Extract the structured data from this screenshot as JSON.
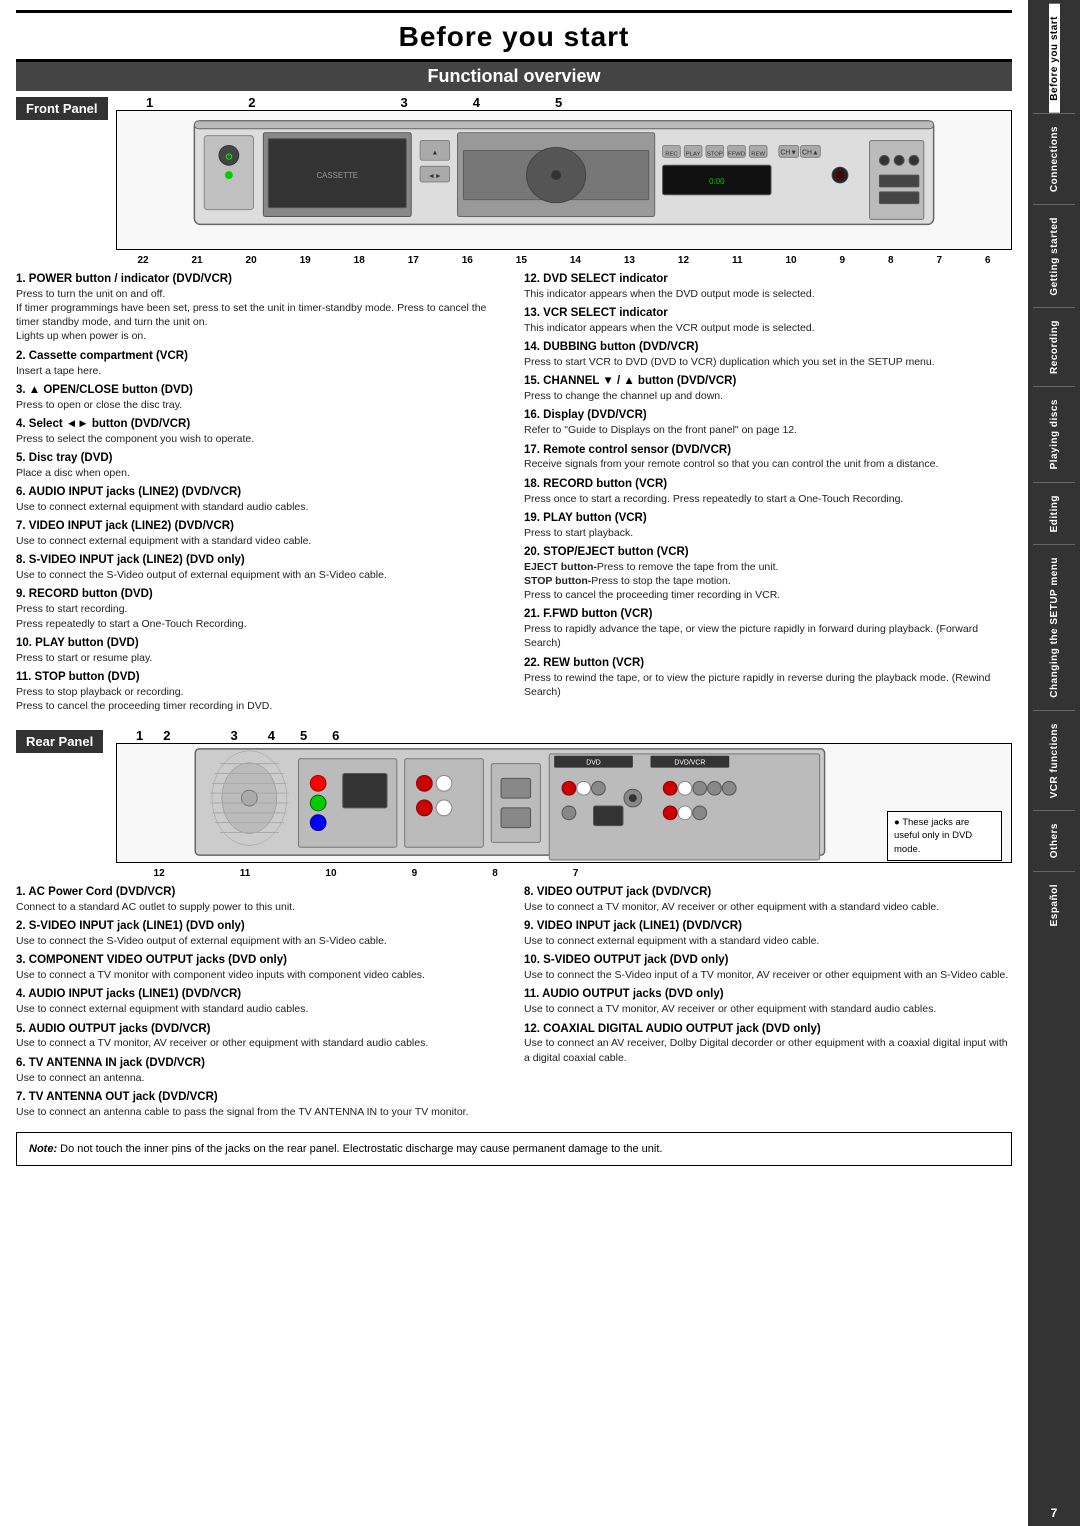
{
  "page": {
    "title": "Before you start",
    "section": "Functional overview",
    "page_number": "7"
  },
  "sidebar": {
    "sections": [
      {
        "label": "Before you start",
        "active": true
      },
      {
        "label": "Connections",
        "active": false
      },
      {
        "label": "Getting started",
        "active": false
      },
      {
        "label": "Recording",
        "active": false
      },
      {
        "label": "Playing discs",
        "active": false
      },
      {
        "label": "Editing",
        "active": false
      },
      {
        "label": "Changing the SETUP menu",
        "active": false
      },
      {
        "label": "VCR functions",
        "active": false
      },
      {
        "label": "Others",
        "active": false
      },
      {
        "label": "Español",
        "active": false
      }
    ]
  },
  "front_panel": {
    "label": "Front Panel",
    "top_numbers": [
      "1",
      "2",
      "3",
      "4",
      "5"
    ],
    "bottom_numbers": [
      "22",
      "21",
      "20",
      "19",
      "18",
      "17",
      "16",
      "15",
      "14",
      "13",
      "12",
      "11",
      "10",
      "9",
      "8",
      "7",
      "6"
    ],
    "items": [
      {
        "num": "1",
        "title": "POWER button / indicator (DVD/VCR)",
        "body": "Press to turn the unit on and off.\nIf timer programmings have been set, press to set the unit in timer-standby mode. Press to cancel the timer standby mode, and turn the unit on.\nLights up when power is on."
      },
      {
        "num": "2",
        "title": "Cassette compartment (VCR)",
        "body": "Insert a tape here."
      },
      {
        "num": "3",
        "title": "▲ OPEN/CLOSE button (DVD)",
        "body": "Press to open or close the disc tray."
      },
      {
        "num": "4",
        "title": "Select ◄► button (DVD/VCR)",
        "body": "Press to select the component you wish to operate."
      },
      {
        "num": "5",
        "title": "Disc tray (DVD)",
        "body": "Place a disc when open."
      },
      {
        "num": "6",
        "title": "AUDIO INPUT jacks (LINE2) (DVD/VCR)",
        "body": "Use to connect external equipment with standard audio cables."
      },
      {
        "num": "7",
        "title": "VIDEO INPUT jack (LINE2) (DVD/VCR)",
        "body": "Use to connect external equipment with a standard video cable."
      },
      {
        "num": "8",
        "title": "S-VIDEO INPUT jack (LINE2) (DVD only)",
        "body": "Use to connect the S-Video output of external equipment with an S-Video cable."
      },
      {
        "num": "9",
        "title": "RECORD button (DVD)",
        "body": "Press to start recording.\nPress repeatedly to start a One-Touch Recording."
      },
      {
        "num": "10",
        "title": "PLAY button (DVD)",
        "body": "Press to start or resume play."
      },
      {
        "num": "11",
        "title": "STOP button (DVD)",
        "body": "Press to stop playback or recording.\nPress to cancel the proceeding timer recording in DVD."
      },
      {
        "num": "12",
        "title": "DVD SELECT indicator",
        "body": "This indicator appears when the DVD output mode is selected."
      },
      {
        "num": "13",
        "title": "VCR SELECT indicator",
        "body": "This indicator appears when the VCR output mode is selected."
      },
      {
        "num": "14",
        "title": "DUBBING button (DVD/VCR)",
        "body": "Press to start VCR to DVD (DVD to VCR) duplication which you set in the SETUP menu."
      },
      {
        "num": "15",
        "title": "CHANNEL ▼ / ▲ button (DVD/VCR)",
        "body": "Press to change the channel up and down."
      },
      {
        "num": "16",
        "title": "Display (DVD/VCR)",
        "body": "Refer to \"Guide to Displays on the front panel\" on page 12."
      },
      {
        "num": "17",
        "title": "Remote control sensor (DVD/VCR)",
        "body": "Receive signals from your remote control so that you can control the unit from a distance."
      },
      {
        "num": "18",
        "title": "RECORD button (VCR)",
        "body": "Press once to start a recording. Press repeatedly to start a One-Touch Recording."
      },
      {
        "num": "19",
        "title": "PLAY button (VCR)",
        "body": "Press to start playback."
      },
      {
        "num": "20",
        "title": "STOP/EJECT button (VCR)",
        "body": "EJECT button-Press to remove the tape from the unit.\nSTOP button-Press to stop the tape motion.\nPress to cancel the proceeding timer recording in VCR."
      },
      {
        "num": "21",
        "title": "F.FWD button (VCR)",
        "body": "Press to rapidly advance the tape, or view the picture rapidly in forward during playback. (Forward Search)"
      },
      {
        "num": "22",
        "title": "REW button (VCR)",
        "body": "Press to rewind the tape, or to view the picture rapidly in reverse during the playback mode. (Rewind Search)"
      }
    ]
  },
  "rear_panel": {
    "label": "Rear Panel",
    "top_numbers": [
      "1",
      "2",
      "3",
      "4",
      "5",
      "6"
    ],
    "bottom_numbers": [
      "12",
      "11",
      "10",
      "9",
      "8",
      "7"
    ],
    "jack_note": "These jacks are useful only in DVD mode.",
    "items": [
      {
        "num": "1",
        "title": "AC Power Cord (DVD/VCR)",
        "body": "Connect to a standard AC outlet to supply power to this unit."
      },
      {
        "num": "2",
        "title": "S-VIDEO INPUT jack (LINE1) (DVD only)",
        "body": "Use to connect the S-Video output of external equipment with an S-Video cable."
      },
      {
        "num": "3",
        "title": "COMPONENT VIDEO OUTPUT jacks (DVD only)",
        "body": "Use to connect a TV monitor with component video inputs with component video cables."
      },
      {
        "num": "4",
        "title": "AUDIO INPUT jacks (LINE1) (DVD/VCR)",
        "body": "Use to connect external equipment with standard audio cables."
      },
      {
        "num": "5",
        "title": "AUDIO OUTPUT jacks (DVD/VCR)",
        "body": "Use to connect a TV monitor, AV receiver or other equipment with standard audio cables."
      },
      {
        "num": "6",
        "title": "TV ANTENNA IN jack (DVD/VCR)",
        "body": "Use to connect an antenna."
      },
      {
        "num": "7",
        "title": "TV ANTENNA OUT jack (DVD/VCR)",
        "body": "Use to connect an antenna cable to pass the signal from the TV ANTENNA IN to your TV monitor."
      },
      {
        "num": "8",
        "title": "VIDEO OUTPUT jack (DVD/VCR)",
        "body": "Use to connect a TV monitor, AV receiver or other equipment with a standard video cable."
      },
      {
        "num": "9",
        "title": "VIDEO INPUT jack (LINE1) (DVD/VCR)",
        "body": "Use to connect external equipment with a standard video cable."
      },
      {
        "num": "10",
        "title": "S-VIDEO OUTPUT jack (DVD only)",
        "body": "Use to connect the S-Video input of a TV monitor, AV receiver or other equipment with an S-Video cable."
      },
      {
        "num": "11",
        "title": "AUDIO OUTPUT jacks (DVD only)",
        "body": "Use to connect a TV monitor, AV receiver or other equipment with standard audio cables."
      },
      {
        "num": "12",
        "title": "COAXIAL DIGITAL AUDIO OUTPUT jack (DVD only)",
        "body": "Use to connect an AV receiver, Dolby Digital decorder or other equipment with a coaxial digital input with a digital coaxial cable."
      }
    ]
  },
  "note": {
    "label": "Note:",
    "text": "Do not touch the inner pins of the jacks on the rear panel. Electrostatic discharge may cause permanent damage to the unit."
  }
}
